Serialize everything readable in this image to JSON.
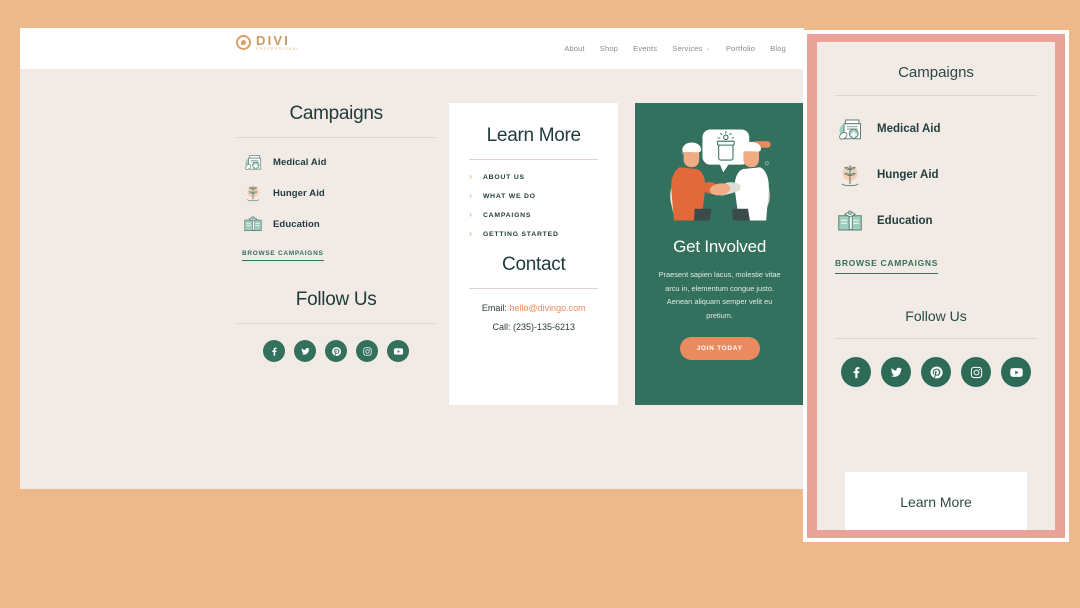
{
  "header": {
    "logo_name": "DIVI",
    "logo_sub": "PROFESSIONAL",
    "logo_icon": "divi-spiral-logo-icon",
    "nav": [
      {
        "label": "About",
        "has_dropdown": false
      },
      {
        "label": "Shop",
        "has_dropdown": false
      },
      {
        "label": "Events",
        "has_dropdown": false
      },
      {
        "label": "Services",
        "has_dropdown": true,
        "caret": "⌄"
      },
      {
        "label": "Portfolio",
        "has_dropdown": false
      },
      {
        "label": "Blog",
        "has_dropdown": false
      }
    ]
  },
  "campaigns": {
    "title": "Campaigns",
    "items": [
      {
        "label": "Medical Aid",
        "icon": "medicine-bottle-icon"
      },
      {
        "label": "Hunger Aid",
        "icon": "sprout-plant-icon"
      },
      {
        "label": "Education",
        "icon": "open-book-graduation-icon"
      }
    ],
    "browse_label": "BROWSE CAMPAIGNS"
  },
  "follow": {
    "title": "Follow Us",
    "socials": [
      {
        "name": "facebook",
        "label": "Facebook"
      },
      {
        "name": "twitter",
        "label": "Twitter"
      },
      {
        "name": "pinterest",
        "label": "Pinterest"
      },
      {
        "name": "instagram",
        "label": "Instagram"
      },
      {
        "name": "youtube",
        "label": "YouTube"
      }
    ]
  },
  "learn_more": {
    "title": "Learn More",
    "links": [
      {
        "label": "ABOUT US",
        "arrow": "›"
      },
      {
        "label": "WHAT WE DO",
        "arrow": "›"
      },
      {
        "label": "CAMPAIGNS",
        "arrow": "›"
      },
      {
        "label": "GETTING STARTED",
        "arrow": "›"
      }
    ]
  },
  "contact": {
    "title": "Contact",
    "email_prefix": "Email:",
    "email": "hello@divingo.com",
    "phone_line": "Call: (235)-135-6213"
  },
  "get_involved": {
    "title": "Get Involved",
    "body": "Praesent sapien lacus, molestie vitae arcu in, elementum congue justo. Aenean aliquam semper velit eu pretium.",
    "cta_label": "JOIN TODAY",
    "illustration": "two-people-handshake-donation-illustration"
  },
  "mobile_preview": {
    "campaigns_title": "Campaigns",
    "items": [
      {
        "label": "Medical Aid",
        "icon": "medicine-bottle-icon"
      },
      {
        "label": "Hunger Aid",
        "icon": "sprout-plant-icon"
      },
      {
        "label": "Education",
        "icon": "open-book-graduation-icon"
      }
    ],
    "browse_label": "BROWSE CAMPAIGNS",
    "follow_title": "Follow Us",
    "socials": [
      {
        "name": "facebook",
        "label": "Facebook"
      },
      {
        "name": "twitter",
        "label": "Twitter"
      },
      {
        "name": "pinterest",
        "label": "Pinterest"
      },
      {
        "name": "instagram",
        "label": "Instagram"
      },
      {
        "name": "youtube",
        "label": "YouTube"
      }
    ],
    "learn_more_title": "Learn More"
  },
  "colors": {
    "page_background": "#eeb98a",
    "body_background": "#f2eae5",
    "dark_green": "#33705e",
    "accent_orange": "#ea8a5f",
    "heading_teal": "#1e3a3a",
    "logo_gold": "#c99a63",
    "mobile_frame": "#eaa399",
    "mint": "#9ecfbe"
  }
}
